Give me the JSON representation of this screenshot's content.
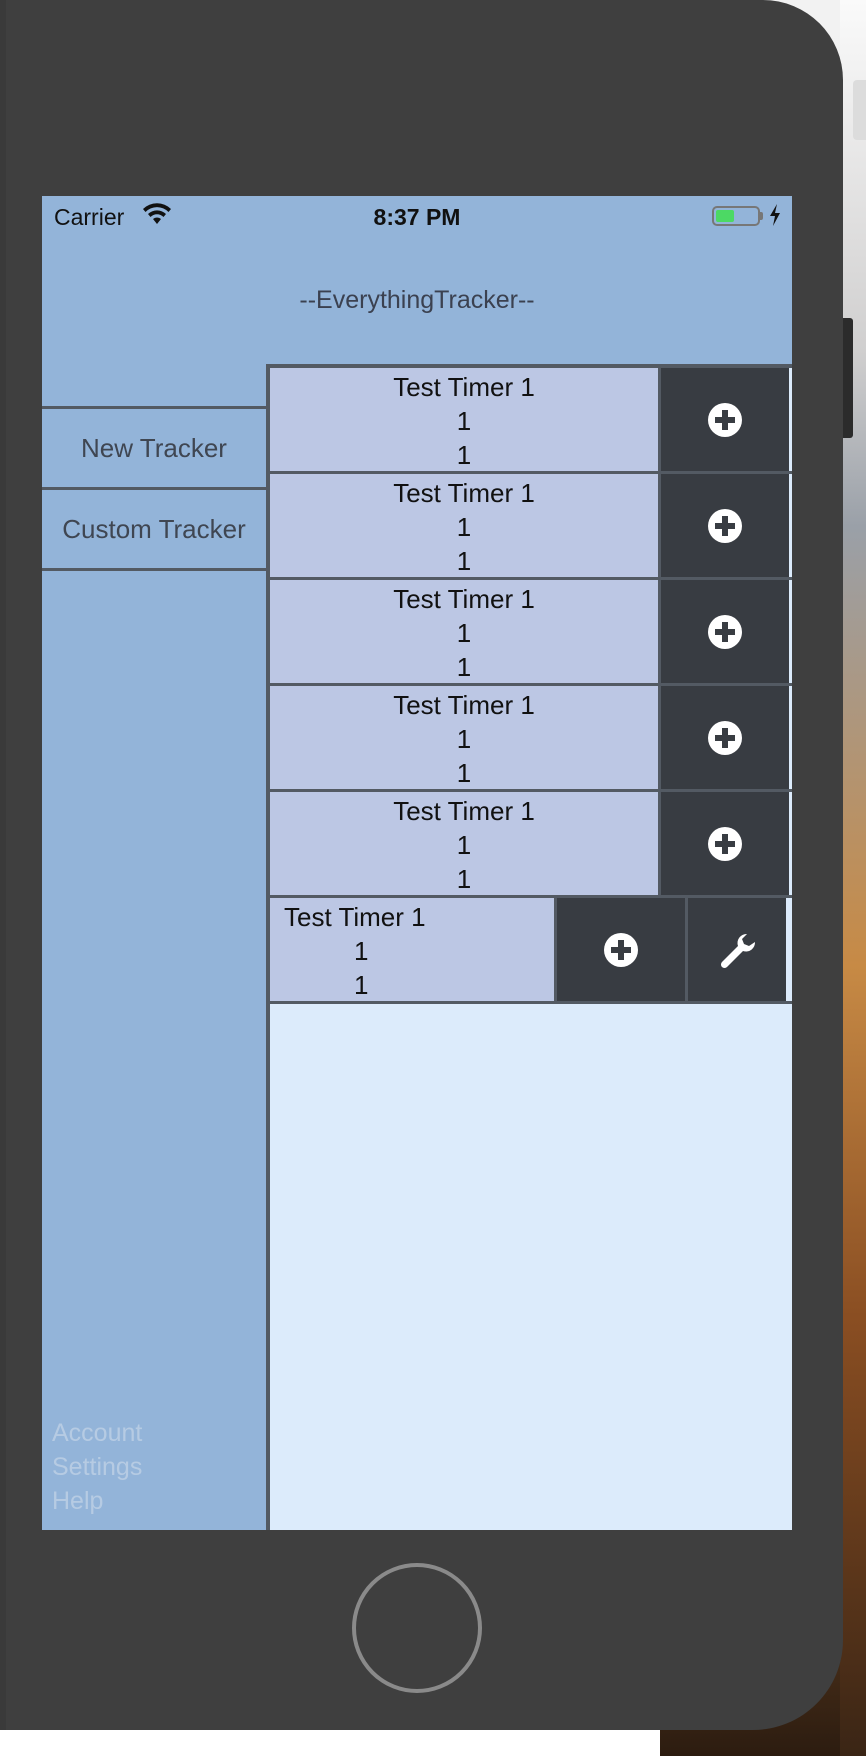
{
  "status_bar": {
    "carrier": "Carrier",
    "time": "8:37 PM",
    "wifi_icon": "wifi-icon",
    "battery_icon": "battery-charging-icon",
    "battery_color": "#4cd964"
  },
  "app": {
    "title": "--EverythingTracker--"
  },
  "sidebar": {
    "new_tracker": "New Tracker",
    "custom_tracker": "Custom Tracker",
    "footer": {
      "account": "Account",
      "settings": "Settings",
      "help": "Help"
    }
  },
  "trackers": [
    {
      "name": "Test Timer 1",
      "value1": "1",
      "value2": "1",
      "actions": [
        "plus-icon"
      ]
    },
    {
      "name": "Test Timer 1",
      "value1": "1",
      "value2": "1",
      "actions": [
        "plus-icon"
      ]
    },
    {
      "name": "Test Timer 1",
      "value1": "1",
      "value2": "1",
      "actions": [
        "plus-icon"
      ]
    },
    {
      "name": "Test Timer 1",
      "value1": "1",
      "value2": "1",
      "actions": [
        "plus-icon"
      ]
    },
    {
      "name": "Test Timer 1",
      "value1": "1",
      "value2": "1",
      "actions": [
        "plus-icon"
      ]
    },
    {
      "name": "Test Timer 1",
      "value1": "1",
      "value2": "1",
      "actions": [
        "plus-icon",
        "wrench-icon"
      ]
    }
  ],
  "colors": {
    "screen_bg": "#93b4d9",
    "panel_bg": "#dcebfb",
    "tracker_bg": "#bcc7e4",
    "button_bg": "#383c42",
    "device_bg": "#3f3f3f"
  }
}
